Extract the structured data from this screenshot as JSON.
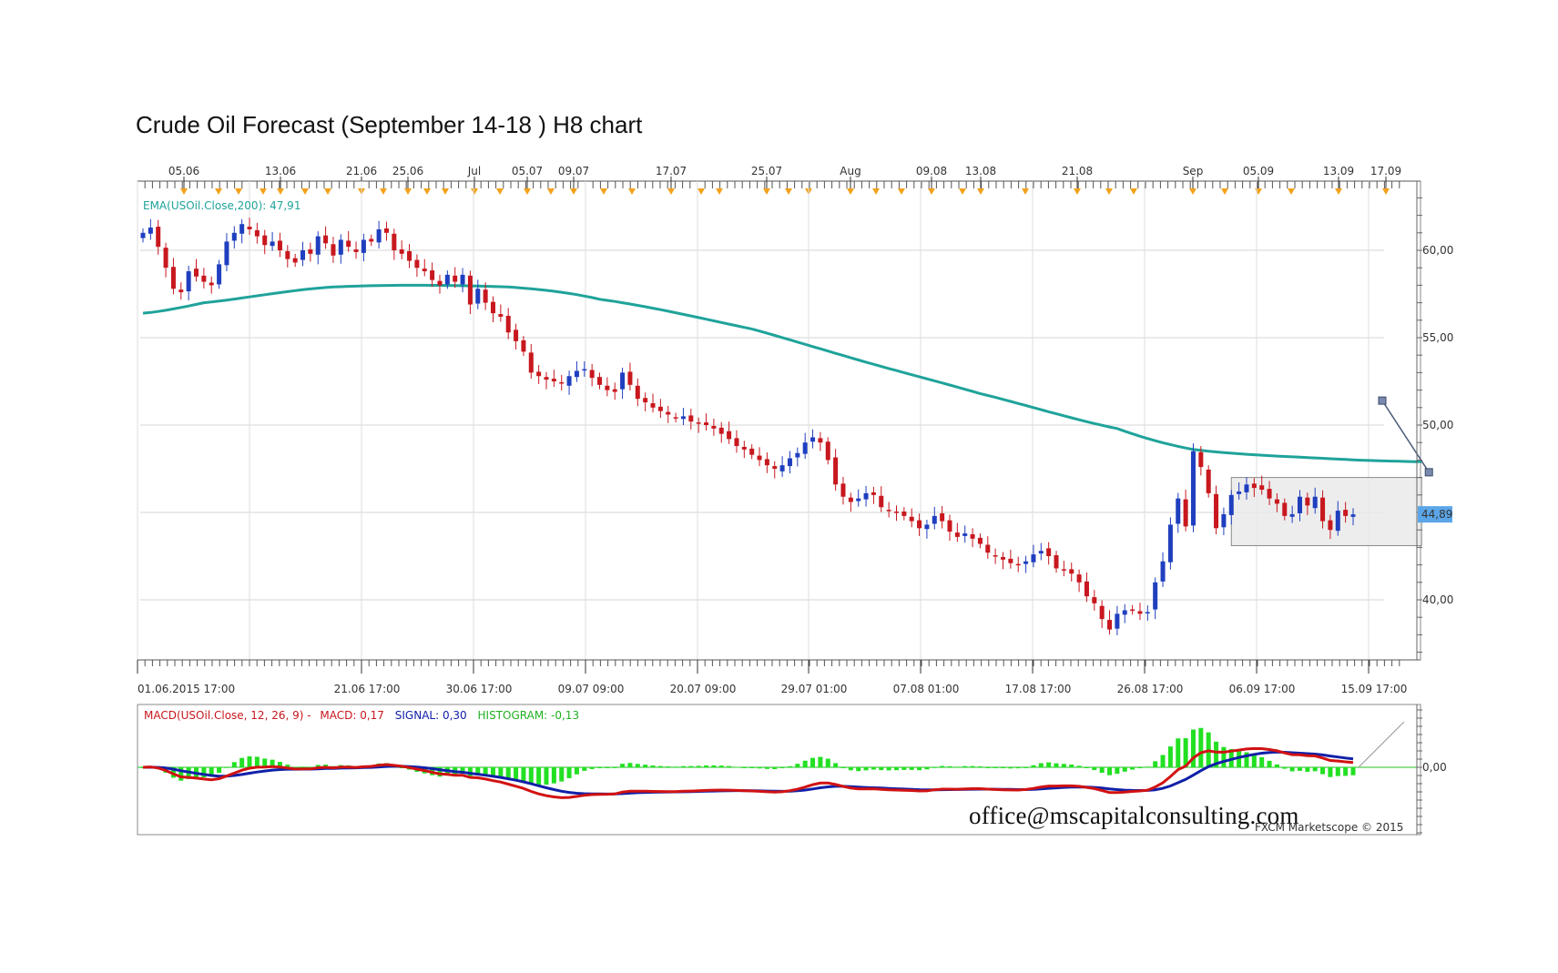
{
  "title": "Crude Oil Forecast (September 14-18 ) H8 chart",
  "watermark": "office@mscapitalconsulting.com",
  "copyright": "FXCM Marketscope © 2015",
  "price_badge": "44,89",
  "legends": {
    "ema": "EMA(USOil.Close,200): 47,91",
    "macd_prefix": "MACD(USOil.Close, 12, 26, 9) -",
    "macd_value": "MACD: 0,17",
    "signal_value": "SIGNAL: 0,30",
    "histogram_value": "HISTOGRAM: -0,13"
  },
  "colors": {
    "bull": "#1F3FBF",
    "bear": "#C8171E",
    "ema": "#1FA39A",
    "macd": "#D11212",
    "signal": "#1020A8",
    "histogram": "#22E022",
    "badge": "#5BA6E8",
    "event_marker": "#F2A21B",
    "forecast": "#4A5A7A"
  },
  "top_axis_labels": [
    "05.06",
    "13.06",
    "21.06",
    "25.06",
    "Jul",
    "05.07",
    "09.07",
    "17.07",
    "25.07",
    "Aug",
    "09.08",
    "13.08",
    "21.08",
    "Sep",
    "05.09",
    "13.09",
    "17.09"
  ],
  "bottom_axis_labels": [
    "01.06.2015 17:00",
    "21.06 17:00",
    "30.06 17:00",
    "09.07 09:00",
    "20.07 09:00",
    "29.07 01:00",
    "07.08 01:00",
    "17.08 17:00",
    "26.08 17:00",
    "06.09 17:00",
    "15.09 17:00"
  ],
  "price_axis_labels": [
    "60,00",
    "55,00",
    "50,00",
    "40,00"
  ],
  "macd_axis_label": "0,00",
  "chart_data": {
    "type": "candlestick",
    "timeframe": "H8",
    "price_range": [
      36.0,
      63.0
    ],
    "grid": true,
    "candles_close_approx": [
      61.0,
      61.3,
      60.2,
      59.0,
      57.8,
      57.6,
      58.8,
      58.5,
      58.2,
      58.0,
      59.2,
      60.5,
      61.0,
      61.5,
      61.2,
      60.8,
      60.3,
      60.5,
      60.0,
      59.5,
      59.3,
      60.0,
      59.8,
      60.8,
      60.4,
      59.7,
      60.6,
      60.2,
      59.9,
      60.6,
      60.5,
      61.2,
      61.0,
      60.0,
      59.8,
      59.4,
      59.0,
      58.8,
      58.3,
      58.0,
      58.6,
      58.2,
      58.6,
      56.9,
      57.8,
      57.0,
      56.4,
      56.2,
      55.3,
      54.8,
      54.2,
      53.0,
      52.8,
      52.6,
      52.5,
      52.4,
      52.8,
      53.1,
      53.2,
      52.7,
      52.3,
      52.0,
      51.9,
      53.0,
      52.3,
      51.5,
      51.3,
      51.0,
      50.8,
      50.6,
      50.4,
      50.5,
      50.2,
      50.1,
      50.0,
      49.8,
      49.5,
      49.2,
      48.8,
      48.6,
      48.3,
      48.0,
      47.7,
      47.5,
      47.7,
      48.1,
      48.4,
      49.0,
      49.3,
      49.0,
      48.0,
      46.6,
      45.9,
      45.6,
      45.8,
      46.1,
      46.0,
      45.3,
      45.1,
      45.0,
      44.8,
      44.5,
      44.1,
      44.3,
      44.8,
      44.5,
      43.9,
      43.6,
      43.8,
      43.5,
      43.2,
      42.7,
      42.5,
      42.3,
      42.1,
      42.0,
      42.2,
      42.6,
      42.8,
      42.5,
      41.8,
      41.7,
      41.5,
      41.0,
      40.2,
      39.8,
      38.9,
      38.3,
      39.2,
      39.4,
      39.4,
      39.2,
      39.3,
      41.0,
      42.2,
      44.3,
      45.8,
      44.2,
      48.5,
      47.6,
      46.1,
      44.1,
      44.9,
      46.0,
      46.2,
      46.6,
      46.4,
      46.3,
      45.8,
      45.5,
      44.8,
      44.9,
      45.9,
      45.4,
      45.9,
      44.5,
      44.0,
      45.1,
      44.8,
      44.89
    ],
    "ema200": {
      "label": "EMA(USOil.Close,200)",
      "last": 47.91,
      "points": [
        [
          0,
          56.4
        ],
        [
          8,
          57.0
        ],
        [
          25,
          57.9
        ],
        [
          48,
          57.9
        ],
        [
          60,
          57.2
        ],
        [
          80,
          55.5
        ],
        [
          95,
          53.6
        ],
        [
          110,
          51.8
        ],
        [
          128,
          49.8
        ],
        [
          138,
          48.6
        ],
        [
          155,
          48.1
        ],
        [
          168,
          47.9
        ]
      ]
    },
    "macd": {
      "params": "12, 26, 9",
      "macd": 0.17,
      "signal": 0.3,
      "histogram": -0.13
    },
    "forecast_projection": [
      [
        168,
        47.3
      ],
      [
        175,
        51.4
      ]
    ],
    "consolidation_box": {
      "x": [
        143,
        168
      ],
      "y": [
        43.1,
        47.0
      ]
    }
  }
}
